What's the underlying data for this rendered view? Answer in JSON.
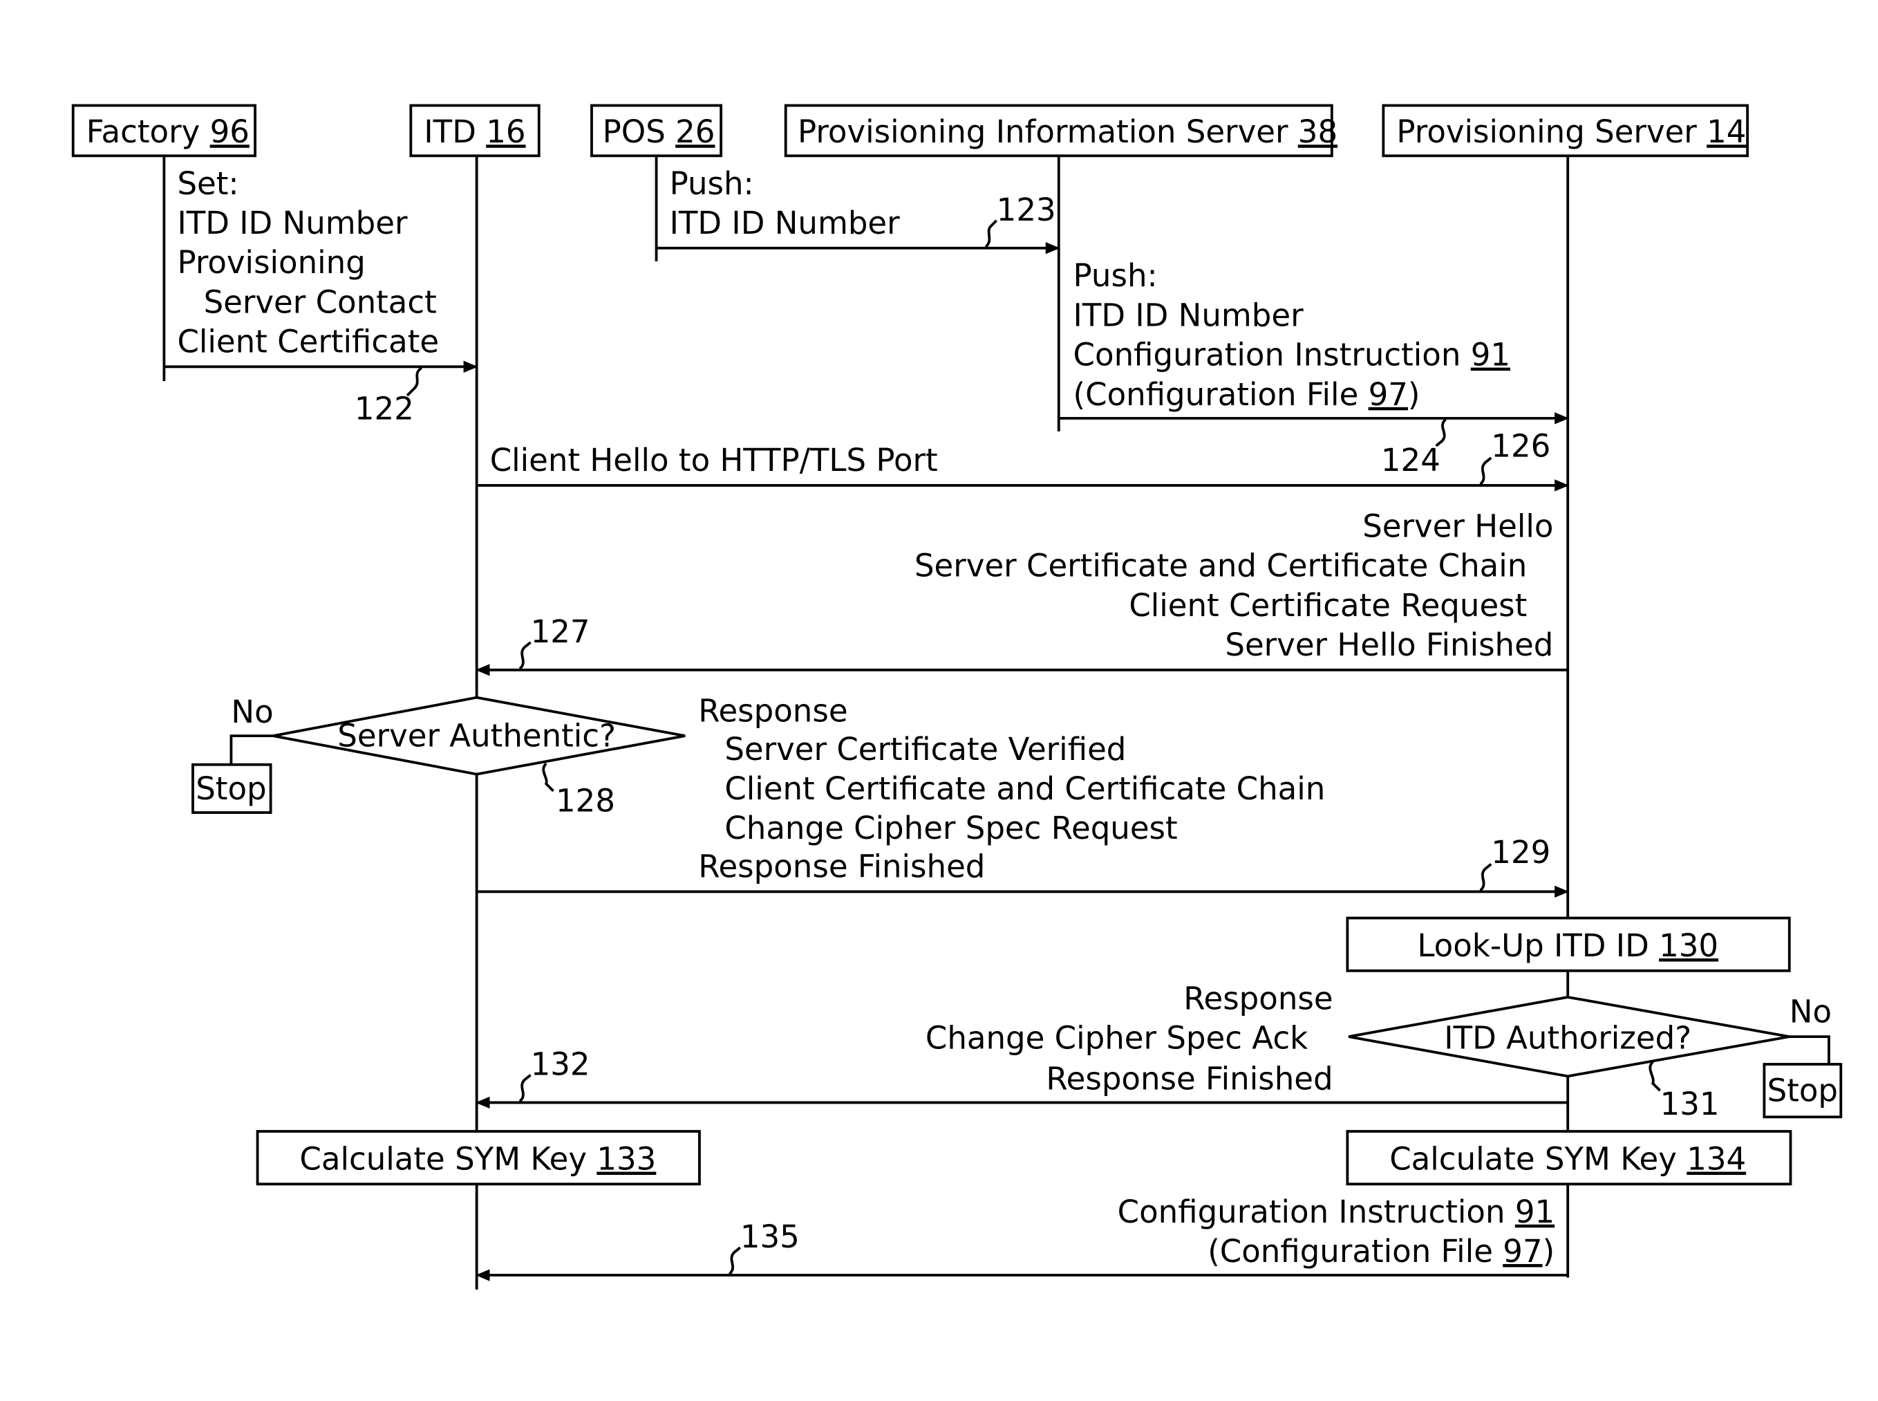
{
  "participants": [
    {
      "label": "Factory",
      "ref": "96"
    },
    {
      "label": "ITD",
      "ref": "16"
    },
    {
      "label": "POS",
      "ref": "26"
    },
    {
      "label": "Provisioning Information Server",
      "ref": "38"
    },
    {
      "label": "Provisioning Server",
      "ref": "14"
    }
  ],
  "messages": {
    "m122": {
      "ref": "122",
      "lines": [
        "Set:",
        "ITD ID Number",
        "Provisioning",
        "  Server Contact",
        "Client Certificate"
      ]
    },
    "m123": {
      "ref": "123",
      "lines": [
        "Push:",
        "ITD ID Number"
      ]
    },
    "m124": {
      "ref": "124",
      "lines": [
        "Push:",
        "ITD ID Number",
        "Configuration Instruction ",
        "(Configuration File "
      ],
      "ref91": "91",
      "ref97": "97",
      "close": ")"
    },
    "m126": {
      "ref": "126",
      "text": "Client Hello to HTTP/TLS Port"
    },
    "m127": {
      "ref": "127",
      "lines": [
        "Server Hello",
        "Server Certificate and Certificate Chain",
        "Client Certificate Request",
        "Server Hello Finished"
      ]
    },
    "m129": {
      "ref": "129",
      "lines": [
        "Response",
        "Server Certificate Verified",
        "Client Certificate and Certificate Chain",
        "Change Cipher Spec Request",
        "Response Finished"
      ]
    },
    "m132": {
      "ref": "132",
      "lines": [
        "Response",
        "Change Cipher Spec Ack",
        "Response Finished"
      ]
    },
    "m135": {
      "ref": "135",
      "lines": [
        "Configuration Instruction ",
        "(Configuration File "
      ],
      "ref91": "91",
      "ref97": "97",
      "close": ")"
    }
  },
  "decisions": {
    "d128": {
      "label": "Server Authentic?",
      "ref": "128",
      "no": "No",
      "stop": "Stop"
    },
    "d131": {
      "label": "ITD Authorized?",
      "ref": "131",
      "no": "No",
      "stop": "Stop"
    }
  },
  "processes": {
    "p130": {
      "label": "Look-Up ITD ID ",
      "ref": "130"
    },
    "p133": {
      "label": "Calculate SYM Key ",
      "ref": "133"
    },
    "p134": {
      "label": "Calculate SYM Key ",
      "ref": "134"
    }
  }
}
